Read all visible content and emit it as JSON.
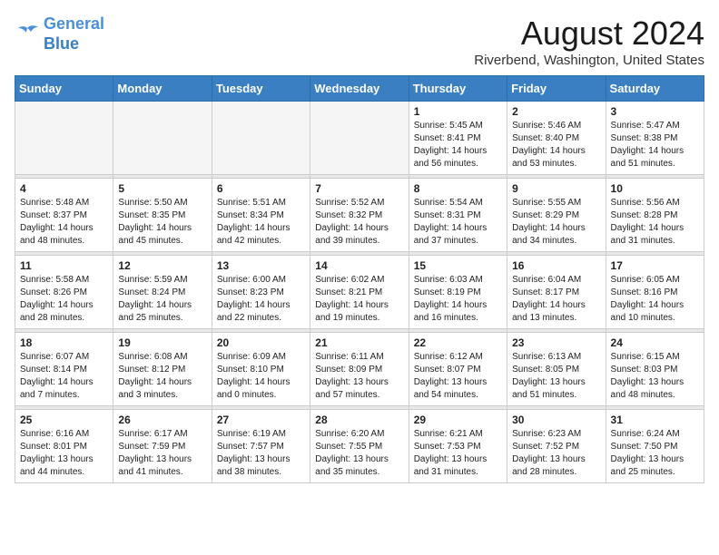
{
  "header": {
    "logo_line1": "General",
    "logo_line2": "Blue",
    "month_title": "August 2024",
    "location": "Riverbend, Washington, United States"
  },
  "weekdays": [
    "Sunday",
    "Monday",
    "Tuesday",
    "Wednesday",
    "Thursday",
    "Friday",
    "Saturday"
  ],
  "weeks": [
    [
      {
        "day": "",
        "info": ""
      },
      {
        "day": "",
        "info": ""
      },
      {
        "day": "",
        "info": ""
      },
      {
        "day": "",
        "info": ""
      },
      {
        "day": "1",
        "info": "Sunrise: 5:45 AM\nSunset: 8:41 PM\nDaylight: 14 hours\nand 56 minutes."
      },
      {
        "day": "2",
        "info": "Sunrise: 5:46 AM\nSunset: 8:40 PM\nDaylight: 14 hours\nand 53 minutes."
      },
      {
        "day": "3",
        "info": "Sunrise: 5:47 AM\nSunset: 8:38 PM\nDaylight: 14 hours\nand 51 minutes."
      }
    ],
    [
      {
        "day": "4",
        "info": "Sunrise: 5:48 AM\nSunset: 8:37 PM\nDaylight: 14 hours\nand 48 minutes."
      },
      {
        "day": "5",
        "info": "Sunrise: 5:50 AM\nSunset: 8:35 PM\nDaylight: 14 hours\nand 45 minutes."
      },
      {
        "day": "6",
        "info": "Sunrise: 5:51 AM\nSunset: 8:34 PM\nDaylight: 14 hours\nand 42 minutes."
      },
      {
        "day": "7",
        "info": "Sunrise: 5:52 AM\nSunset: 8:32 PM\nDaylight: 14 hours\nand 39 minutes."
      },
      {
        "day": "8",
        "info": "Sunrise: 5:54 AM\nSunset: 8:31 PM\nDaylight: 14 hours\nand 37 minutes."
      },
      {
        "day": "9",
        "info": "Sunrise: 5:55 AM\nSunset: 8:29 PM\nDaylight: 14 hours\nand 34 minutes."
      },
      {
        "day": "10",
        "info": "Sunrise: 5:56 AM\nSunset: 8:28 PM\nDaylight: 14 hours\nand 31 minutes."
      }
    ],
    [
      {
        "day": "11",
        "info": "Sunrise: 5:58 AM\nSunset: 8:26 PM\nDaylight: 14 hours\nand 28 minutes."
      },
      {
        "day": "12",
        "info": "Sunrise: 5:59 AM\nSunset: 8:24 PM\nDaylight: 14 hours\nand 25 minutes."
      },
      {
        "day": "13",
        "info": "Sunrise: 6:00 AM\nSunset: 8:23 PM\nDaylight: 14 hours\nand 22 minutes."
      },
      {
        "day": "14",
        "info": "Sunrise: 6:02 AM\nSunset: 8:21 PM\nDaylight: 14 hours\nand 19 minutes."
      },
      {
        "day": "15",
        "info": "Sunrise: 6:03 AM\nSunset: 8:19 PM\nDaylight: 14 hours\nand 16 minutes."
      },
      {
        "day": "16",
        "info": "Sunrise: 6:04 AM\nSunset: 8:17 PM\nDaylight: 14 hours\nand 13 minutes."
      },
      {
        "day": "17",
        "info": "Sunrise: 6:05 AM\nSunset: 8:16 PM\nDaylight: 14 hours\nand 10 minutes."
      }
    ],
    [
      {
        "day": "18",
        "info": "Sunrise: 6:07 AM\nSunset: 8:14 PM\nDaylight: 14 hours\nand 7 minutes."
      },
      {
        "day": "19",
        "info": "Sunrise: 6:08 AM\nSunset: 8:12 PM\nDaylight: 14 hours\nand 3 minutes."
      },
      {
        "day": "20",
        "info": "Sunrise: 6:09 AM\nSunset: 8:10 PM\nDaylight: 14 hours\nand 0 minutes."
      },
      {
        "day": "21",
        "info": "Sunrise: 6:11 AM\nSunset: 8:09 PM\nDaylight: 13 hours\nand 57 minutes."
      },
      {
        "day": "22",
        "info": "Sunrise: 6:12 AM\nSunset: 8:07 PM\nDaylight: 13 hours\nand 54 minutes."
      },
      {
        "day": "23",
        "info": "Sunrise: 6:13 AM\nSunset: 8:05 PM\nDaylight: 13 hours\nand 51 minutes."
      },
      {
        "day": "24",
        "info": "Sunrise: 6:15 AM\nSunset: 8:03 PM\nDaylight: 13 hours\nand 48 minutes."
      }
    ],
    [
      {
        "day": "25",
        "info": "Sunrise: 6:16 AM\nSunset: 8:01 PM\nDaylight: 13 hours\nand 44 minutes."
      },
      {
        "day": "26",
        "info": "Sunrise: 6:17 AM\nSunset: 7:59 PM\nDaylight: 13 hours\nand 41 minutes."
      },
      {
        "day": "27",
        "info": "Sunrise: 6:19 AM\nSunset: 7:57 PM\nDaylight: 13 hours\nand 38 minutes."
      },
      {
        "day": "28",
        "info": "Sunrise: 6:20 AM\nSunset: 7:55 PM\nDaylight: 13 hours\nand 35 minutes."
      },
      {
        "day": "29",
        "info": "Sunrise: 6:21 AM\nSunset: 7:53 PM\nDaylight: 13 hours\nand 31 minutes."
      },
      {
        "day": "30",
        "info": "Sunrise: 6:23 AM\nSunset: 7:52 PM\nDaylight: 13 hours\nand 28 minutes."
      },
      {
        "day": "31",
        "info": "Sunrise: 6:24 AM\nSunset: 7:50 PM\nDaylight: 13 hours\nand 25 minutes."
      }
    ]
  ]
}
